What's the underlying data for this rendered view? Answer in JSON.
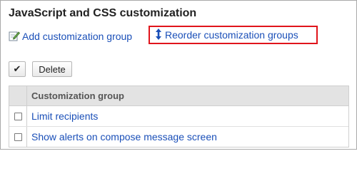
{
  "page": {
    "title": "JavaScript and CSS customization"
  },
  "actions": {
    "add_label": "Add customization group",
    "reorder_label": "Reorder customization groups"
  },
  "toolbar": {
    "select_all_glyph": "✔",
    "delete_label": "Delete"
  },
  "table": {
    "header": "Customization group",
    "rows": [
      {
        "name": "Limit recipients"
      },
      {
        "name": "Show alerts on compose message screen"
      }
    ]
  },
  "colors": {
    "link": "#1a4fb8",
    "highlight_border": "#e0141b",
    "header_bg": "#e3e3e3"
  },
  "icons": {
    "add": "edit-pencil-icon",
    "reorder": "vertical-arrows-icon"
  }
}
